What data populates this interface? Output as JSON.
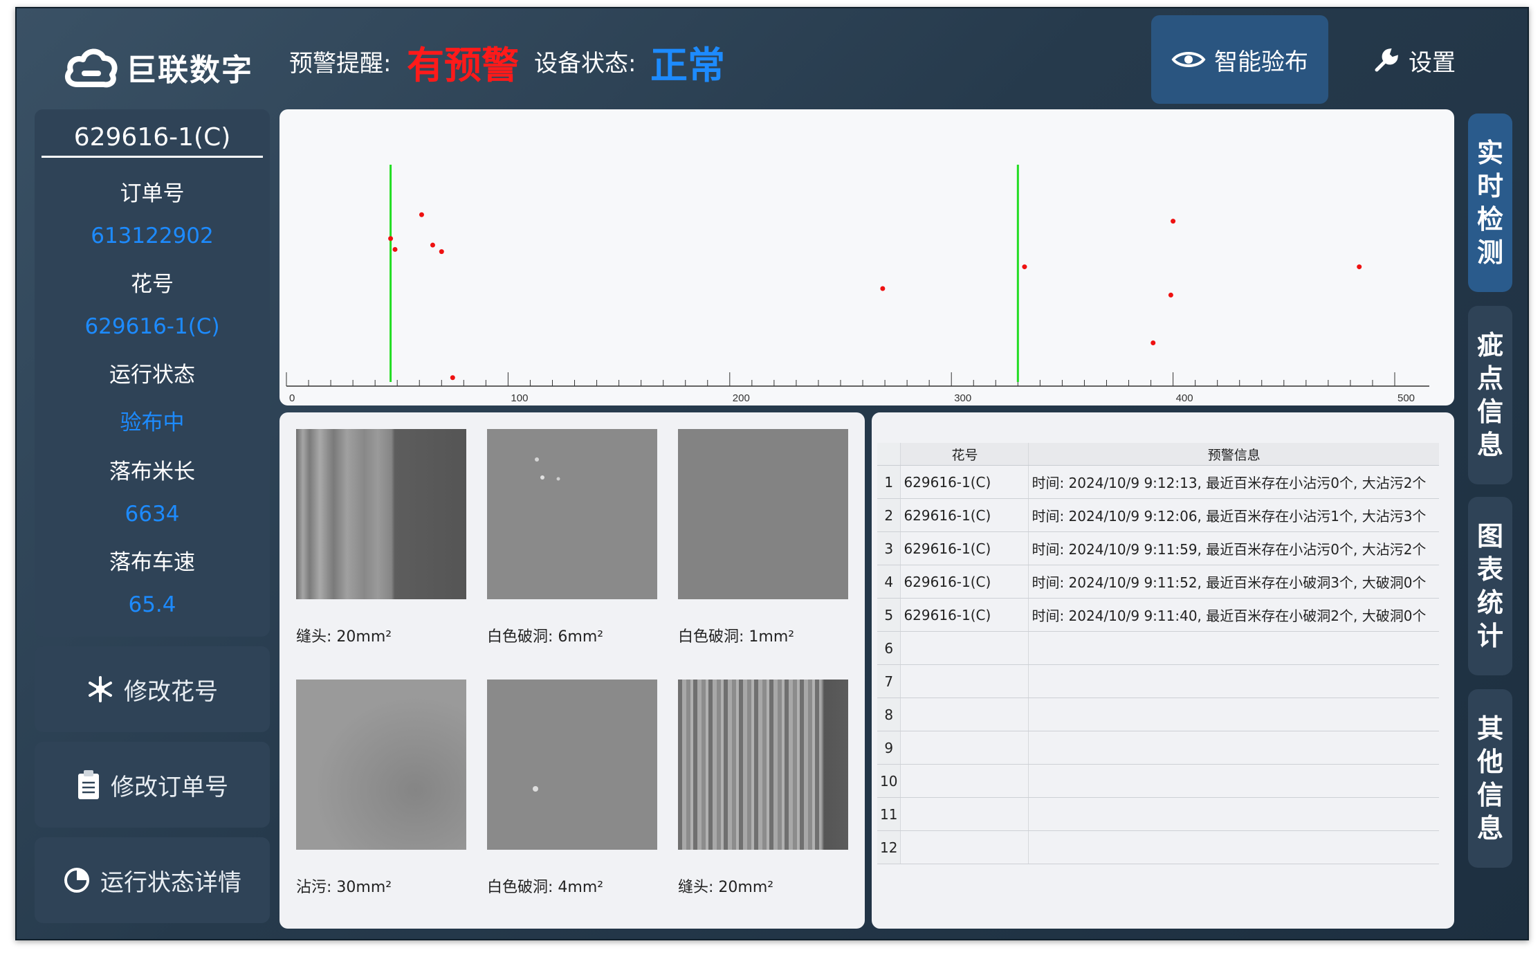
{
  "header": {
    "brand": "巨联数字",
    "alert_label": "预警提醒:",
    "alert_value": "有预警",
    "alert_color": "#ff1a1a",
    "device_label": "设备状态:",
    "device_value": "正常",
    "device_color": "#1d8bff",
    "smart_button": "智能验布",
    "settings_button": "设置"
  },
  "info": {
    "code": "629616-1(C)",
    "order_label": "订单号",
    "order_value": "613122902",
    "flower_label": "花号",
    "flower_value": "629616-1(C)",
    "status_label": "运行状态",
    "status_value": "验布中",
    "length_label": "落布米长",
    "length_value": "6634",
    "speed_label": "落布车速",
    "speed_value": "65.4"
  },
  "side_buttons": {
    "modify_flower": "修改花号",
    "modify_order": "修改订单号",
    "status_detail": "运行状态详情"
  },
  "right_tabs": [
    {
      "label": "实时检测",
      "active": true
    },
    {
      "label": "疵点信息",
      "active": false
    },
    {
      "label": "图表统计",
      "active": false
    },
    {
      "label": "其他信息",
      "active": false
    }
  ],
  "chart_data": {
    "type": "scatter",
    "xlim": [
      0,
      500
    ],
    "x_ticks": [
      "0",
      "100",
      "200",
      "300",
      "400",
      "500"
    ],
    "marker_lines": [
      47,
      330
    ],
    "marker_color": "#22dd22",
    "point_color": "#ee1111",
    "points": [
      {
        "x": 47,
        "y": 0.66
      },
      {
        "x": 49,
        "y": 0.61
      },
      {
        "x": 61,
        "y": 0.77
      },
      {
        "x": 66,
        "y": 0.63
      },
      {
        "x": 70,
        "y": 0.6
      },
      {
        "x": 75,
        "y": 0.02
      },
      {
        "x": 269,
        "y": 0.43
      },
      {
        "x": 333,
        "y": 0.53
      },
      {
        "x": 391,
        "y": 0.18
      },
      {
        "x": 399,
        "y": 0.4
      },
      {
        "x": 400,
        "y": 0.74
      },
      {
        "x": 484,
        "y": 0.53
      }
    ]
  },
  "defect_images": [
    {
      "caption": "缝头: 20mm²",
      "kind": "seam"
    },
    {
      "caption": "白色破洞: 6mm²",
      "kind": "hole"
    },
    {
      "caption": "白色破洞: 1mm²",
      "kind": "plain"
    },
    {
      "caption": "沾污: 30mm²",
      "kind": "stain"
    },
    {
      "caption": "白色破洞: 4mm²",
      "kind": "hole2"
    },
    {
      "caption": "缝头: 20mm²",
      "kind": "seam2"
    }
  ],
  "table": {
    "headers": [
      "花号",
      "预警信息"
    ],
    "rows": [
      {
        "idx": "1",
        "flower": "629616-1(C)",
        "info": "时间: 2024/10/9 9:12:13, 最近百米存在小沾污0个, 大沾污2个"
      },
      {
        "idx": "2",
        "flower": "629616-1(C)",
        "info": "时间: 2024/10/9 9:12:06, 最近百米存在小沾污1个, 大沾污3个"
      },
      {
        "idx": "3",
        "flower": "629616-1(C)",
        "info": "时间: 2024/10/9 9:11:59, 最近百米存在小沾污0个, 大沾污2个"
      },
      {
        "idx": "4",
        "flower": "629616-1(C)",
        "info": "时间: 2024/10/9 9:11:52, 最近百米存在小破洞3个, 大破洞0个"
      },
      {
        "idx": "5",
        "flower": "629616-1(C)",
        "info": "时间: 2024/10/9 9:11:40, 最近百米存在小破洞2个, 大破洞0个"
      },
      {
        "idx": "6",
        "flower": "",
        "info": ""
      },
      {
        "idx": "7",
        "flower": "",
        "info": ""
      },
      {
        "idx": "8",
        "flower": "",
        "info": ""
      },
      {
        "idx": "9",
        "flower": "",
        "info": ""
      },
      {
        "idx": "10",
        "flower": "",
        "info": ""
      },
      {
        "idx": "11",
        "flower": "",
        "info": ""
      },
      {
        "idx": "12",
        "flower": "",
        "info": ""
      }
    ]
  }
}
